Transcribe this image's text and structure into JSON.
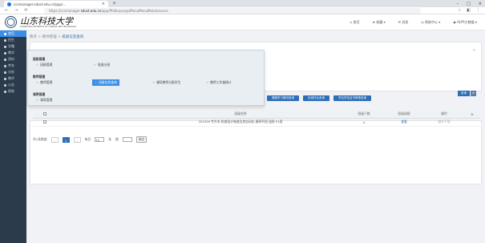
{
  "browser": {
    "tab_title": "ccsmanager.sdust.edu.cn/ppp/...",
    "url_prefix": "https://ccsmanager.",
    "url_host": "sdust.edu.cn",
    "url_path": "/ppp/PfsBaiyangs/ManaMenuMaintenance"
  },
  "header": {
    "logo_text": "山东科技大学",
    "logo_sub": "SHANDONG UNIVERSITY OF SCIENCE AND TECHNOLOGY",
    "nav": [
      "首页",
      "收藏",
      "消息",
      "帮助中心",
      "ALYR大数据"
    ]
  },
  "sidebar": {
    "items": [
      "首页",
      "招生",
      "学籍",
      "教学",
      "资料",
      "考务",
      "分析",
      "教评",
      "公告",
      "帮助"
    ]
  },
  "breadcrumb": {
    "parts": [
      "教务",
      "教师管理",
      "班级信息查询"
    ]
  },
  "menu": {
    "groups": [
      {
        "title": "班级管理",
        "items": [
          "班级管理",
          "批量分班"
        ]
      },
      {
        "title": "教师管理",
        "items": [
          "教师管理",
          "班级信息查询",
          "辅导教师分配学生",
          "教师工作量统计"
        ]
      },
      {
        "title": "课表管理",
        "items": [
          "课表管理"
        ]
      }
    ],
    "active": "班级信息查询"
  },
  "toolbar": {
    "buttons": [
      "课程学习情况查询",
      "在线作业查询",
      "学位学位证书审核查询"
    ],
    "search_label": "查询"
  },
  "table": {
    "headers": [
      "",
      "",
      "班级名称",
      "班级人数",
      "班级成绩",
      "操作"
    ],
    "rows": [
      {
        "name": "201509 专升本 机械设计制造及其自动化 春季开班 函授 01班",
        "count": "4",
        "score": "查看",
        "op": "操作下载"
      }
    ]
  },
  "pager": {
    "summary": "共1条数据",
    "current": "1",
    "per_page_label": "每页",
    "per_page": "10",
    "unit": "条",
    "goto_label": "跳",
    "go": "确定"
  }
}
